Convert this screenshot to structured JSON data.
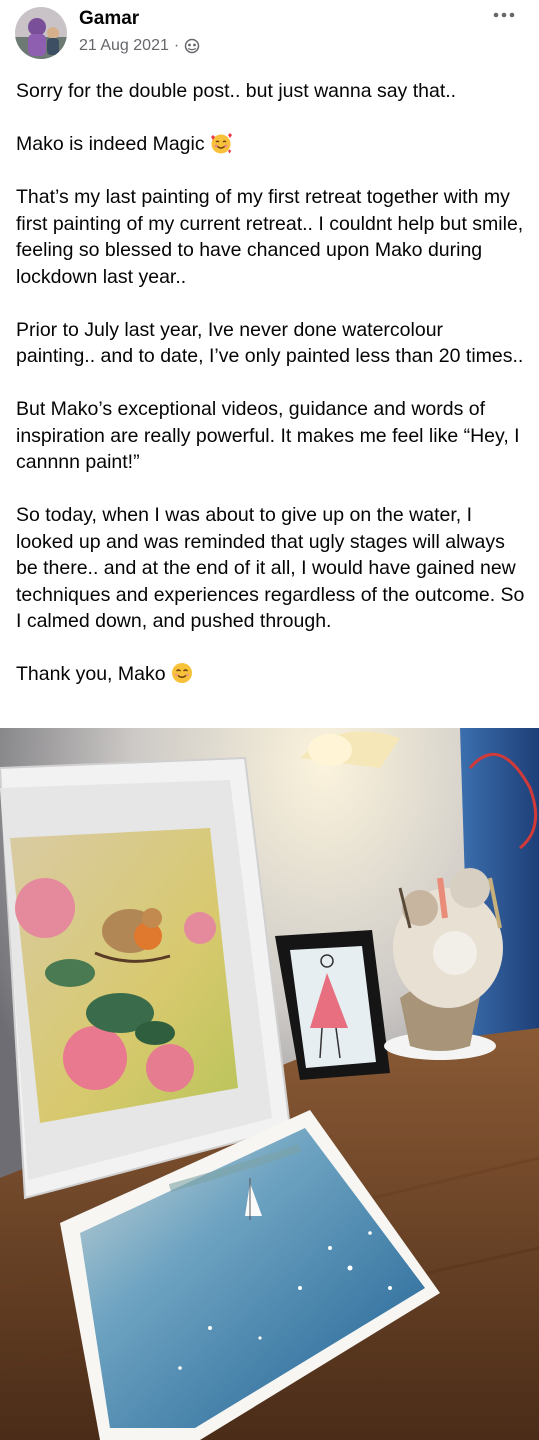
{
  "post": {
    "author": "Gamar",
    "date": "21 Aug 2021",
    "separator": "·",
    "audience_icon": "globe-icon",
    "more_icon": "more-options-icon",
    "paragraphs": {
      "p1": "Sorry for the double post.. but just wanna say that..",
      "p2": "Mako is indeed Magic",
      "p3": "That’s my last painting of my first retreat together with my first painting of my current retreat.. I couldnt help but smile, feeling so blessed to have chanced upon Mako during lockdown last year..",
      "p4": "Prior to July last year, Ive never done watercolour painting.. and to date, I’ve only painted less than 20 times..",
      "p5": "But Mako’s exceptional videos, guidance and words of inspiration are really powerful. It makes me feel like “Hey, I cannnn paint!”",
      "p6": "So today, when I was about to give up on the water, I looked up and was reminded that ugly stages will always be there.. and at the end of it all, I would have gained new techniques and experiences regardless of the outcome. So I calmed down, and pushed through.",
      "p7": "Thank you, Mako"
    },
    "emojis": {
      "p2": "smiling-face-with-hearts-emoji",
      "p7": "smiling-face-emoji"
    }
  },
  "colors": {
    "text": "#050505",
    "meta": "#65676b",
    "background": "#ffffff"
  }
}
